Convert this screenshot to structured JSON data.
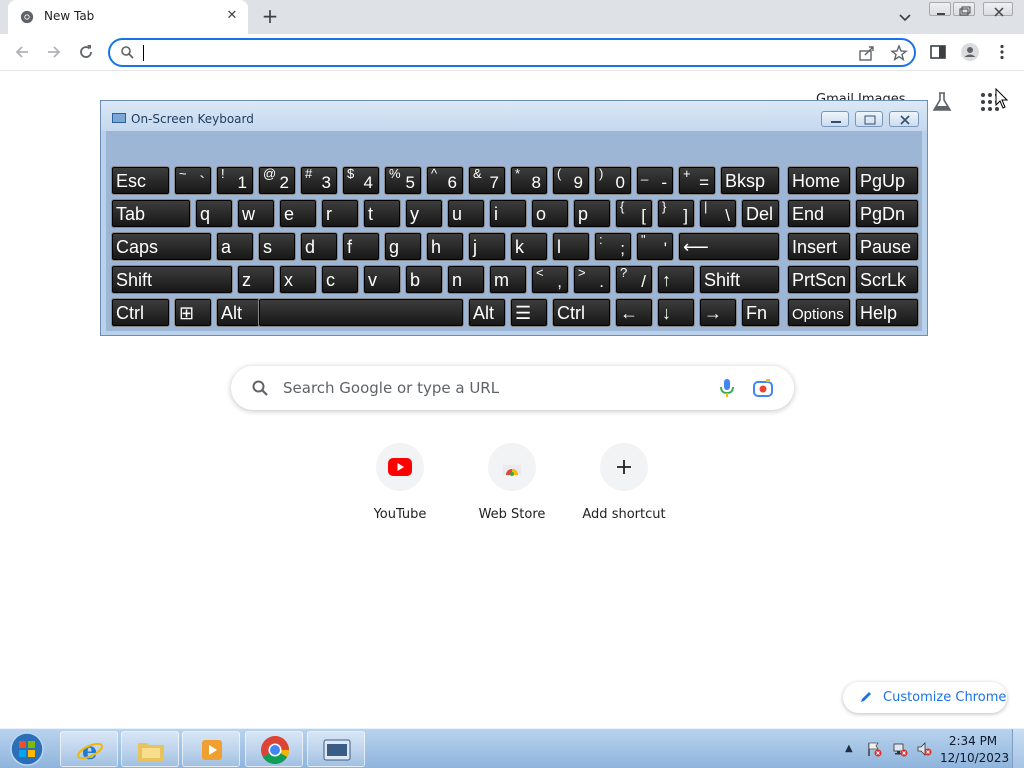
{
  "browser": {
    "tab": {
      "title": "New Tab",
      "close_glyph": "✕"
    },
    "new_tab_glyph": "+",
    "omnibox": {
      "value": "",
      "placeholder": ""
    }
  },
  "ntp": {
    "top_link": "Gmail Images",
    "search_placeholder": "Search Google or type a URL",
    "shortcuts": [
      {
        "label": "YouTube",
        "icon": "youtube-icon"
      },
      {
        "label": "Web Store",
        "icon": "webstore-icon"
      },
      {
        "label": "Add shortcut",
        "icon": "plus-icon"
      }
    ],
    "customize_label": "Customize Chrome"
  },
  "osk": {
    "title": "On-Screen Keyboard",
    "rows": [
      [
        {
          "t": "Esc"
        },
        {
          "s": "~",
          "b": "`"
        },
        {
          "s": "!",
          "b": "1"
        },
        {
          "s": "@",
          "b": "2"
        },
        {
          "s": "#",
          "b": "3"
        },
        {
          "s": "$",
          "b": "4"
        },
        {
          "s": "%",
          "b": "5"
        },
        {
          "s": "^",
          "b": "6"
        },
        {
          "s": "&",
          "b": "7"
        },
        {
          "s": "*",
          "b": "8"
        },
        {
          "s": "(",
          "b": "9"
        },
        {
          "s": ")",
          "b": "0"
        },
        {
          "s": "_",
          "b": "-"
        },
        {
          "s": "+",
          "b": "="
        },
        {
          "t": "Bksp"
        },
        {
          "t": "Home"
        },
        {
          "t": "PgUp"
        }
      ],
      [
        {
          "t": "Tab"
        },
        {
          "t": "q"
        },
        {
          "t": "w"
        },
        {
          "t": "e"
        },
        {
          "t": "r"
        },
        {
          "t": "t"
        },
        {
          "t": "y"
        },
        {
          "t": "u"
        },
        {
          "t": "i"
        },
        {
          "t": "o"
        },
        {
          "t": "p"
        },
        {
          "s": "{",
          "b": "["
        },
        {
          "s": "}",
          "b": "]"
        },
        {
          "s": "|",
          "b": "\\"
        },
        {
          "t": "Del"
        },
        {
          "t": "End"
        },
        {
          "t": "PgDn"
        }
      ],
      [
        {
          "t": "Caps"
        },
        {
          "t": "a"
        },
        {
          "t": "s"
        },
        {
          "t": "d"
        },
        {
          "t": "f"
        },
        {
          "t": "g"
        },
        {
          "t": "h"
        },
        {
          "t": "j"
        },
        {
          "t": "k"
        },
        {
          "t": "l"
        },
        {
          "s": ":",
          "b": ";"
        },
        {
          "s": "\"",
          "b": "'"
        },
        {
          "t": "⟵"
        },
        {
          "t": "Insert"
        },
        {
          "t": "Pause"
        }
      ],
      [
        {
          "t": "Shift"
        },
        {
          "t": "z"
        },
        {
          "t": "x"
        },
        {
          "t": "c"
        },
        {
          "t": "v"
        },
        {
          "t": "b"
        },
        {
          "t": "n"
        },
        {
          "t": "m"
        },
        {
          "s": "<",
          "b": ","
        },
        {
          "s": ">",
          "b": "."
        },
        {
          "s": "?",
          "b": "/"
        },
        {
          "t": "↑"
        },
        {
          "t": "Shift"
        },
        {
          "t": "PrtScn"
        },
        {
          "t": "ScrLk"
        }
      ],
      [
        {
          "t": "Ctrl"
        },
        {
          "t": "⊞"
        },
        {
          "t": "Alt"
        },
        {
          "t": ""
        },
        {
          "t": "Alt"
        },
        {
          "t": "☰"
        },
        {
          "t": "Ctrl"
        },
        {
          "t": "←"
        },
        {
          "t": "↓"
        },
        {
          "t": "→"
        },
        {
          "t": "Fn"
        },
        {
          "t": "Options"
        },
        {
          "t": "Help"
        }
      ]
    ]
  },
  "taskbar": {
    "items": [
      "internet-explorer-icon",
      "file-explorer-icon",
      "media-player-icon",
      "chrome-icon",
      "on-screen-keyboard-icon"
    ],
    "time": "2:34 PM",
    "date": "12/10/2023",
    "tray_arrow": "▲"
  }
}
